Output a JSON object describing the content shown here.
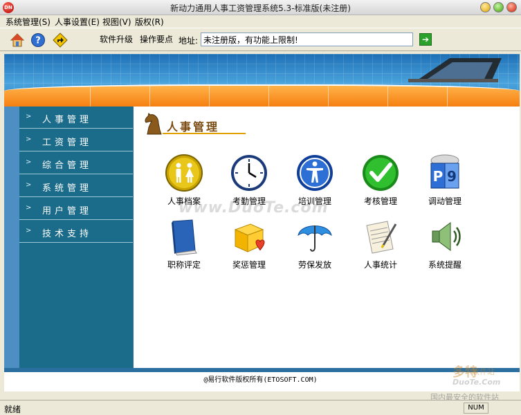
{
  "window": {
    "title": "新动力通用人事工资管理系统5.3-标准版(未注册)",
    "app_icon_text": "DN"
  },
  "menu": [
    {
      "label": "系统管理(S)"
    },
    {
      "label": "人事设置(E)"
    },
    {
      "label": "视图(V)"
    },
    {
      "label": "版权(R)"
    }
  ],
  "toolbar": {
    "icons": [
      "home-icon",
      "help-icon",
      "forward-icon"
    ],
    "buttons": [
      {
        "label": "软件升级"
      },
      {
        "label": "操作要点"
      }
    ],
    "address_label": "地址:",
    "address_value": "未注册版，有功能上限制!",
    "go_icon": "arrow-right-icon"
  },
  "sidebar": {
    "items": [
      {
        "label": "人事管理"
      },
      {
        "label": "工资管理"
      },
      {
        "label": "综合管理"
      },
      {
        "label": "系统管理"
      },
      {
        "label": "用户管理"
      },
      {
        "label": "技术支持"
      }
    ]
  },
  "main": {
    "section_title": "人事管理",
    "tiles": [
      {
        "label": "人事档案",
        "icon": "restroom-people-icon"
      },
      {
        "label": "考勤管理",
        "icon": "clock-icon"
      },
      {
        "label": "培训管理",
        "icon": "accessibility-person-icon"
      },
      {
        "label": "考核管理",
        "icon": "checkmark-icon"
      },
      {
        "label": "调动管理",
        "icon": "transfer-faces-icon"
      },
      {
        "label": "职称评定",
        "icon": "book-icon"
      },
      {
        "label": "奖惩管理",
        "icon": "gift-box-heart-icon"
      },
      {
        "label": "劳保发放",
        "icon": "umbrella-icon"
      },
      {
        "label": "人事统计",
        "icon": "document-pen-icon"
      },
      {
        "label": "系统提醒",
        "icon": "speaker-icon"
      }
    ],
    "watermark": "www.DuoTe.com"
  },
  "footer": {
    "copyright": "@易行软件版权所有(ETOSOFT.COM)"
  },
  "watermark_logo": {
    "name": "多特",
    "tag": "软件站",
    "domain": "DuoTe.Com",
    "slogan": "国内最安全的软件站"
  },
  "statusbar": {
    "text": "就绪",
    "num": "NUM"
  }
}
